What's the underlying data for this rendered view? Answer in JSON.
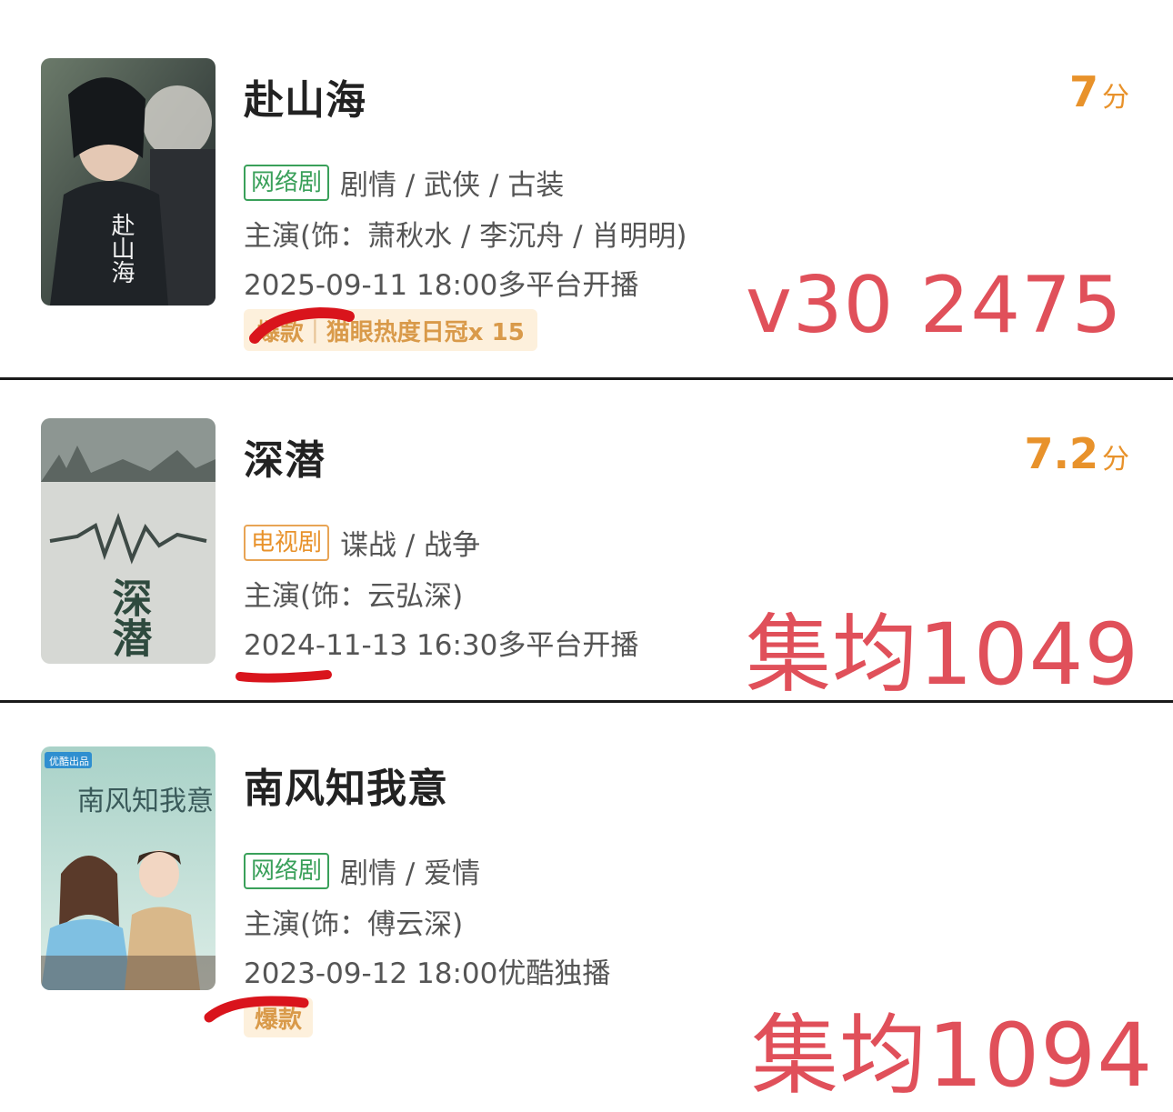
{
  "items": [
    {
      "title": "赴山海",
      "score": "7",
      "score_unit": "分",
      "category_tag": "网络剧",
      "genres": "剧情 / 武侠 / 古装",
      "cast": "主演(饰：萧秋水 / 李沉舟 / 肖明明)",
      "release": "2025-09-11 18:00多平台开播",
      "badge_label": "爆款",
      "badge_text": "猫眼热度日冠x 15",
      "annotation": "v30 2475",
      "poster_text": "赴山海",
      "poster_icon": "drama-poster-image"
    },
    {
      "title": "深潜",
      "score": "7.2",
      "score_unit": "分",
      "category_tag": "电视剧",
      "genres": "谍战 / 战争",
      "cast": "主演(饰：云弘深)",
      "release": "2024-11-13 16:30多平台开播",
      "annotation": "集均1049",
      "poster_text": "深潜",
      "poster_icon": "drama-poster-image"
    },
    {
      "title": "南风知我意",
      "category_tag": "网络剧",
      "genres": "剧情 / 爱情",
      "cast": "主演(饰：傅云深)",
      "release": "2023-09-12 18:00优酷独播",
      "badge_label": "爆款",
      "annotation": "集均1094",
      "poster_text": "南风知我意",
      "poster_badge": "优酷出品",
      "poster_icon": "drama-poster-image"
    }
  ],
  "colors": {
    "score": "#e8922b",
    "tag_green": "#3aa05a",
    "tag_orange": "#e8922b",
    "annotation_red": "#e0505a",
    "badge_bg": "#fdf0dc"
  }
}
